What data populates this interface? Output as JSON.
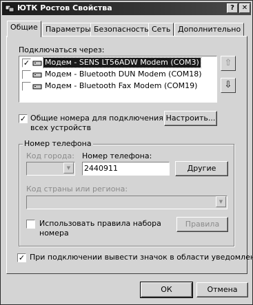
{
  "window": {
    "title": "ЮТК Ростов Свойства",
    "help_glyph": "?",
    "close_glyph": "✕"
  },
  "tabs": [
    {
      "label": "Общие",
      "active": true
    },
    {
      "label": "Параметры"
    },
    {
      "label": "Безопасность"
    },
    {
      "label": "Сеть"
    },
    {
      "label": "Дополнительно"
    }
  ],
  "connect_via": {
    "label": "Подключаться через:",
    "devices": [
      {
        "label": "Модем - SENS LT56ADW Modem (COM3)",
        "checked": true,
        "selected": true
      },
      {
        "label": "Модем - Bluetooth DUN Modem (COM18)",
        "checked": false
      },
      {
        "label": "Модем - Bluetooth Fax Modem (COM19)",
        "checked": false
      }
    ],
    "up_glyph": "⇧",
    "down_glyph": "⇩"
  },
  "shared_numbers": {
    "checked": true,
    "label_line1": "Общие номера для подключения",
    "label_line2": "всех устройств",
    "configure_label": "Настроить..."
  },
  "phone": {
    "group_label": "Номер телефона",
    "area_code_label": "Код города:",
    "area_code_value": "",
    "number_label": "Номер телефона:",
    "number_value": "2440911",
    "others_label": "Другие",
    "country_label": "Код страны или региона:",
    "country_value": "",
    "dial_rules_checked": false,
    "dial_rules_line1": "Использовать правила набора",
    "dial_rules_line2": "номера",
    "rules_label": "Правила"
  },
  "notify": {
    "checked": true,
    "label": "При подключении вывести значок в области уведомлений"
  },
  "footer": {
    "ok_label": "ОК",
    "cancel_label": "Отмена"
  },
  "colors": {
    "title_bar": "#1a1a1a",
    "selection": "#1a1a1a",
    "face": "#d4d4d4"
  }
}
